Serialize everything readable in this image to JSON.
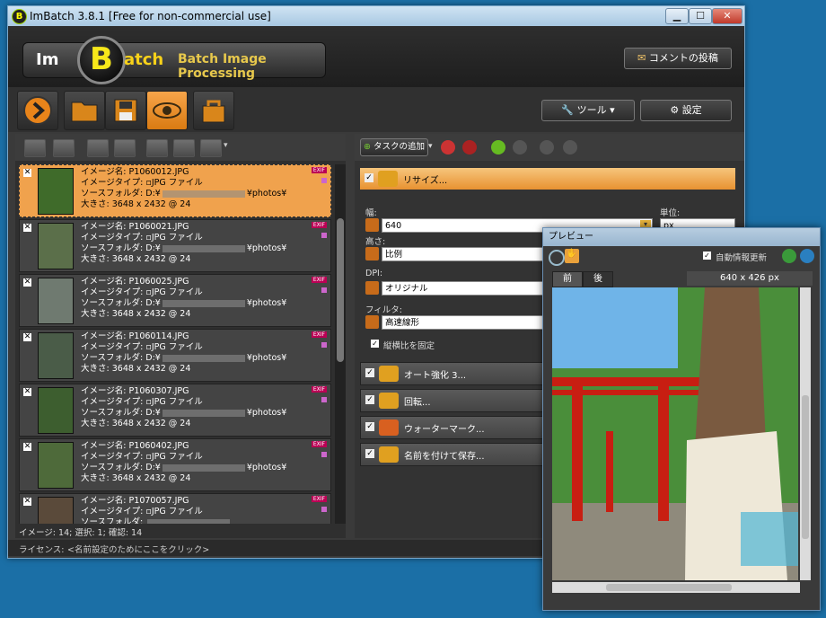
{
  "window": {
    "title": "ImBatch 3.8.1 [Free for non-commercial use]",
    "controls": {
      "minimize": "▁",
      "maximize": "☐",
      "close": "✕"
    }
  },
  "header": {
    "logo_im": "Im",
    "logo_b": "B",
    "logo_atch": "atch",
    "tagline": "Batch Image Processing",
    "comment_button": "コメントの投稿"
  },
  "toolbar": {
    "tools_button": "ツール",
    "settings_button": "設定"
  },
  "image_list": {
    "labels": {
      "name": "イメージ名:",
      "type": "イメージタイプ:",
      "folder": "ソースフォルダ:",
      "size": "大きさ:"
    },
    "items": [
      {
        "name": "P1060012.JPG",
        "type": "JPG ファイル",
        "folder": "D:¥",
        "folder_end": "¥photos¥",
        "size": "3648 x 2432 @ 24",
        "selected": true
      },
      {
        "name": "P1060021.JPG",
        "type": "JPG ファイル",
        "folder": "D:¥",
        "folder_end": "¥photos¥",
        "size": "3648 x 2432 @ 24"
      },
      {
        "name": "P1060025.JPG",
        "type": "JPG ファイル",
        "folder": "D:¥",
        "folder_end": "¥photos¥",
        "size": "3648 x 2432 @ 24"
      },
      {
        "name": "P1060114.JPG",
        "type": "JPG ファイル",
        "folder": "D:¥",
        "folder_end": "¥photos¥",
        "size": "3648 x 2432 @ 24"
      },
      {
        "name": "P1060307.JPG",
        "type": "JPG ファイル",
        "folder": "D:¥",
        "folder_end": "¥photos¥",
        "size": "3648 x 2432 @ 24"
      },
      {
        "name": "P1060402.JPG",
        "type": "JPG ファイル",
        "folder": "D:¥",
        "folder_end": "¥photos¥",
        "size": "3648 x 2432 @ 24"
      },
      {
        "name": "P1070057.JPG",
        "type": "JPG ファイル",
        "folder": "",
        "folder_end": "",
        "size": ""
      }
    ],
    "exif_label": "EXIF",
    "status": "イメージ: 14; 選択: 1; 確認: 14"
  },
  "license_bar": {
    "label": "ライセンス:",
    "value": "<名前設定のためにここをクリック>"
  },
  "tasks": {
    "add_task": "タスクの追加",
    "resize": {
      "label": "リサイズ...",
      "width_label": "幅:",
      "width_value": "640",
      "unit_label": "単位:",
      "unit_value": "px",
      "height_label": "高さ:",
      "height_value": "比例",
      "dpi_label": "DPI:",
      "dpi_value": "オリジナル",
      "filter_label": "フィルタ:",
      "filter_value": "高速線形",
      "keep_aspect": "縦横比を固定"
    },
    "others": [
      {
        "label": "オート強化 3..."
      },
      {
        "label": "回転..."
      },
      {
        "label": "ウォーターマーク..."
      },
      {
        "label": "名前を付けて保存..."
      }
    ]
  },
  "preview": {
    "title": "プレビュー",
    "auto_update": "自動情報更新",
    "tab_before": "前",
    "tab_after": "後",
    "size": "640 x 426 px"
  }
}
